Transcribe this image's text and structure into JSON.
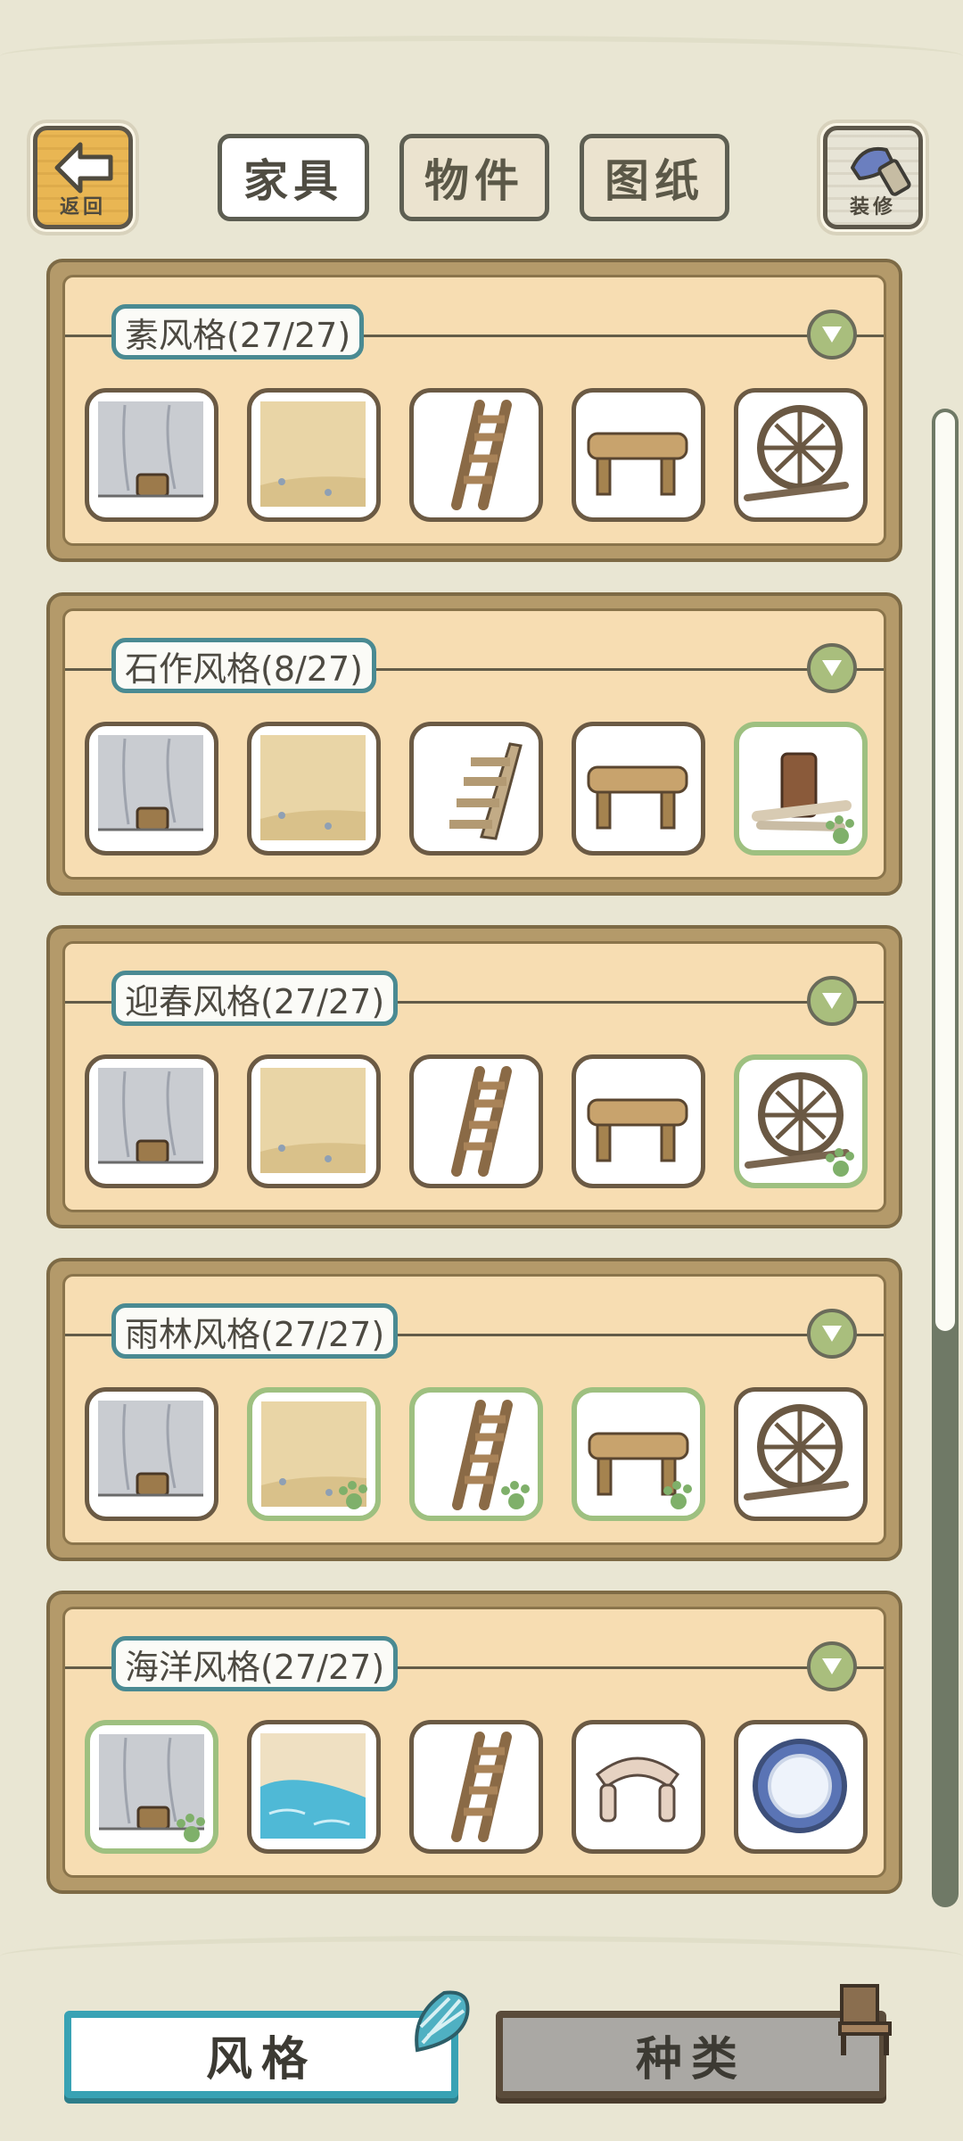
{
  "header": {
    "back_label": "返回",
    "decorate_label": "装修",
    "tabs": [
      {
        "label": "家具",
        "active": true
      },
      {
        "label": "物件",
        "active": false
      },
      {
        "label": "图纸",
        "active": false
      }
    ]
  },
  "categories": [
    {
      "title": "素风格(27/27)",
      "items": [
        {
          "icon": "wall-icon",
          "selected": false
        },
        {
          "icon": "floor-icon",
          "selected": false
        },
        {
          "icon": "ladder-icon",
          "selected": false
        },
        {
          "icon": "table-icon",
          "selected": false
        },
        {
          "icon": "window-icon",
          "selected": false
        }
      ]
    },
    {
      "title": "石作风格(8/27)",
      "items": [
        {
          "icon": "wall-icon",
          "selected": false
        },
        {
          "icon": "floor-icon",
          "selected": false
        },
        {
          "icon": "stairs-icon",
          "selected": false
        },
        {
          "icon": "table-icon",
          "selected": false
        },
        {
          "icon": "stump-icon",
          "selected": true
        }
      ]
    },
    {
      "title": "迎春风格(27/27)",
      "items": [
        {
          "icon": "wall-icon",
          "selected": false
        },
        {
          "icon": "floor-icon",
          "selected": false
        },
        {
          "icon": "ladder-icon",
          "selected": false
        },
        {
          "icon": "table-icon",
          "selected": false
        },
        {
          "icon": "window-icon",
          "selected": true
        }
      ]
    },
    {
      "title": "雨林风格(27/27)",
      "items": [
        {
          "icon": "wall-icon",
          "selected": false
        },
        {
          "icon": "floor-icon",
          "selected": true
        },
        {
          "icon": "ladder-icon",
          "selected": true
        },
        {
          "icon": "table-icon",
          "selected": true
        },
        {
          "icon": "window-icon",
          "selected": false
        }
      ]
    },
    {
      "title": "海洋风格(27/27)",
      "items": [
        {
          "icon": "wall-icon",
          "selected": true
        },
        {
          "icon": "water-floor-icon",
          "selected": false
        },
        {
          "icon": "ladder-icon",
          "selected": false
        },
        {
          "icon": "shell-table-icon",
          "selected": false
        },
        {
          "icon": "porthole-window-icon",
          "selected": false
        }
      ]
    }
  ],
  "footer": {
    "style_label": "风格",
    "type_label": "种类"
  },
  "colors": {
    "background": "#e9e6d3",
    "panel": "#f7ddb2",
    "accent": "#38a2b4",
    "selected": "#9ec080"
  }
}
